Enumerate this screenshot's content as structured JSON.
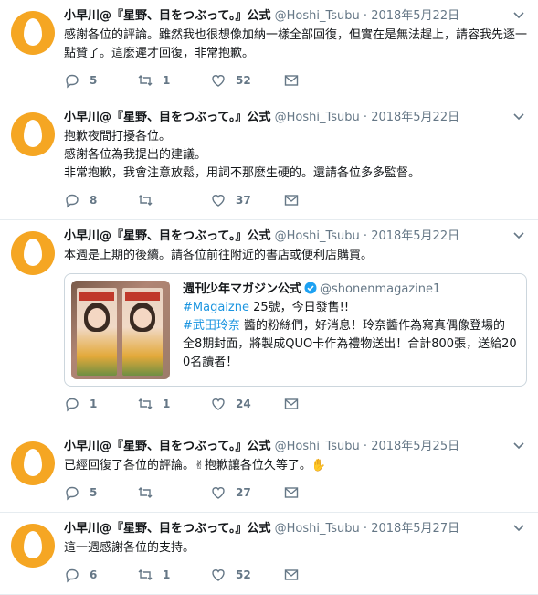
{
  "author": {
    "name": "小早川@『星野、目をつぶって。』公式",
    "handle": "@Hoshi_Tsubu"
  },
  "separator": "·",
  "colors": {
    "accent": "#1b95e0",
    "avatar": "#f5a623",
    "muted": "#657786"
  },
  "icons": {
    "reply": "reply-icon",
    "retweet": "retweet-icon",
    "like": "heart-icon",
    "share": "envelope-icon",
    "more": "chevron-down-icon",
    "verified": "verified-badge-icon"
  },
  "tweets": [
    {
      "date": "2018年5月22日",
      "text": "感謝各位的評論。雖然我也很想像加納一樣全部回復，但實在是無法趕上，請容我先逐一點贊了。這麼遲才回復，非常抱歉。",
      "replies": "5",
      "retweets": "1",
      "likes": "52"
    },
    {
      "date": "2018年5月22日",
      "text": "抱歉夜間打擾各位。\n感謝各位為我提出的建議。\n非常抱歉，我會注意放鬆，用詞不那麼生硬的。還請各位多多監督。",
      "replies": "8",
      "retweets": "",
      "likes": "37"
    },
    {
      "date": "2018年5月22日",
      "text": "本週是上期的後續。請各位前往附近的書店或便利店購買。",
      "replies": "1",
      "retweets": "1",
      "likes": "24",
      "quote": {
        "name": "週刊少年マガジン公式",
        "handle": "@shonenmagazine1",
        "hashtag1": "#Magaizne",
        "line1_rest": " 25號，今日發售!!",
        "hashtag2": "#武田玲奈",
        "line2_rest": " 醬的粉絲們，好消息！玲奈醬作為寫真偶像登場的全8期封面，將製成QUO卡作為禮物送出！合計800張，送給200名讀者！"
      }
    },
    {
      "date": "2018年5月25日",
      "text": "已經回復了各位的評論。✌抱歉讓各位久等了。✋",
      "replies": "5",
      "retweets": "",
      "likes": "27"
    },
    {
      "date": "2018年5月27日",
      "text": "這一週感謝各位的支持。",
      "replies": "6",
      "retweets": "1",
      "likes": "52"
    }
  ]
}
